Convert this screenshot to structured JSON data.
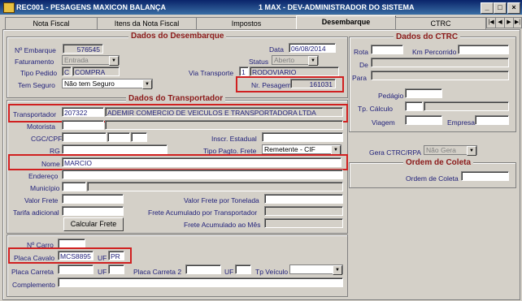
{
  "window": {
    "title": "REC001 - PESAGENS MAXICON BALANÇA",
    "subtitle": "1  MAX - DEV-ADMINISTRADOR DO SISTEMA",
    "btn_min": "_",
    "btn_max": "□",
    "btn_close": "×"
  },
  "tabs": [
    {
      "label": "Nota Fiscal"
    },
    {
      "label": "Itens da Nota Fiscal"
    },
    {
      "label": "Impostos"
    },
    {
      "label": "Desembarque"
    },
    {
      "label": "CTRC"
    }
  ],
  "tab_nav": {
    "first": "|◀",
    "prev": "◀",
    "next": "▶",
    "last": "▶|"
  },
  "desembarque": {
    "section_title": "Dados do Desembarque",
    "num_embarque_label": "Nº Embarque",
    "num_embarque": "576545",
    "data_label": "Data",
    "data": "06/08/2014",
    "faturamento_label": "Faturamento",
    "faturamento": "Entrada",
    "status_label": "Status",
    "status": "Aberto",
    "tipo_pedido_label": "Tipo Pedido",
    "tipo_pedido_code": "C",
    "tipo_pedido": "COMPRA",
    "via_transporte_label": "Via Transporte",
    "via_transporte_code": "1",
    "via_transporte": "RODOVIARIO",
    "tem_seguro_label": "Tem Seguro",
    "tem_seguro": "Não tem Seguro",
    "nr_pesagem_label": "Nr. Pesagem",
    "nr_pesagem": "161031"
  },
  "transportador": {
    "section_title": "Dados do Transportador",
    "transportador_label": "Transportador",
    "transportador_code": "207322",
    "transportador_name": "ADEMIR COMERCIO DE VEICULOS E TRANSPORTADORA LTDA",
    "motorista_label": "Motorista",
    "cgc_label": "CGC/CPF",
    "inscr_label": "Inscr. Estadual",
    "rg_label": "RG",
    "tipo_frete_label": "Tipo Pagto. Frete",
    "tipo_frete": "Remetente - CIF",
    "nome_label": "Nome",
    "nome": "MARCIO",
    "endereco_label": "Endereço",
    "municipio_label": "Município",
    "valor_frete_label": "Valor Frete",
    "valor_frete_ton_label": "Valor Frete por Tonelada",
    "tarifa_label": "Tarifa adicional",
    "frete_acum_transp_label": "Frete Acumulado por Transportador",
    "calcular_frete_label": "Calcular Frete",
    "frete_acum_mes_label": "Frete Acumulado ao Mês"
  },
  "veiculo": {
    "num_carro_label": "Nº Carro",
    "placa_cavalo_label": "Placa Cavalo",
    "placa_cavalo": "MCS8895",
    "uf_label": "UF",
    "uf": "PR",
    "placa_carreta_label": "Placa Carreta",
    "placa_carreta2_label": "Placa Carreta 2",
    "tp_veiculo_label": "Tp Veículo",
    "complemento_label": "Complemento"
  },
  "ctrc": {
    "section_title": "Dados do CTRC",
    "rota_label": "Rota",
    "km_label": "Km Percorrido",
    "de_label": "De",
    "para_label": "Para",
    "pedagio_label": "Pedágio",
    "tp_calculo_label": "Tp. Cálculo",
    "viagem_label": "Viagem",
    "empresa_label": "Empresa",
    "gera_label": "Gera CTRC/RPA",
    "gera": "Não Gera"
  },
  "coleta": {
    "section_title": "Ordem de Coleta",
    "ordem_label": "Ordem de Coleta"
  }
}
